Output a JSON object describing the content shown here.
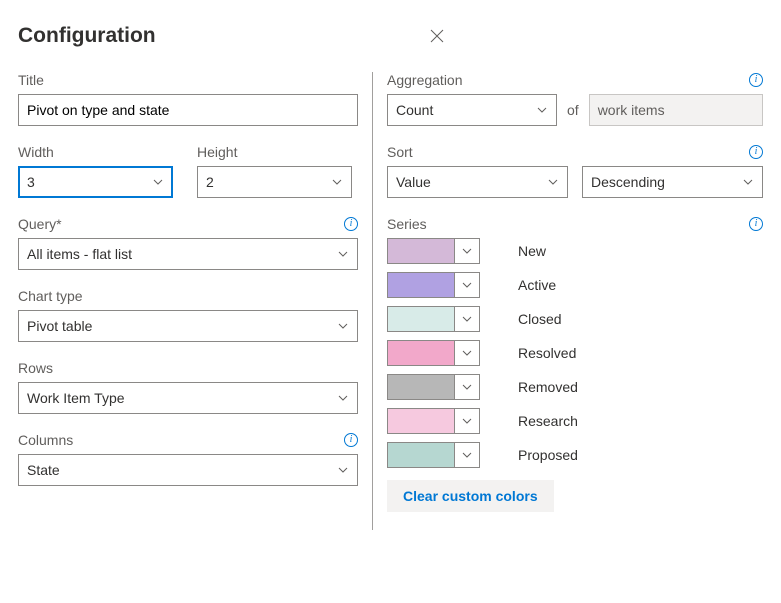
{
  "header": {
    "title": "Configuration"
  },
  "left": {
    "title_label": "Title",
    "title_value": "Pivot on type and state",
    "width_label": "Width",
    "width_value": "3",
    "height_label": "Height",
    "height_value": "2",
    "query_label": "Query*",
    "query_value": "All items - flat list",
    "charttype_label": "Chart type",
    "charttype_value": "Pivot table",
    "rows_label": "Rows",
    "rows_value": "Work Item Type",
    "columns_label": "Columns",
    "columns_value": "State"
  },
  "right": {
    "aggregation_label": "Aggregation",
    "aggregation_value": "Count",
    "of_label": "of",
    "target_value": "work items",
    "sort_label": "Sort",
    "sort_by_value": "Value",
    "sort_dir_value": "Descending",
    "series_label": "Series",
    "series": [
      {
        "label": "New",
        "color": "#d4b9d8"
      },
      {
        "label": "Active",
        "color": "#b0a1e2"
      },
      {
        "label": "Closed",
        "color": "#d8ebe8"
      },
      {
        "label": "Resolved",
        "color": "#f2a8ca"
      },
      {
        "label": "Removed",
        "color": "#b7b7b7"
      },
      {
        "label": "Research",
        "color": "#f6c9df"
      },
      {
        "label": "Proposed",
        "color": "#b6d7d1"
      }
    ],
    "clear_label": "Clear custom colors"
  }
}
